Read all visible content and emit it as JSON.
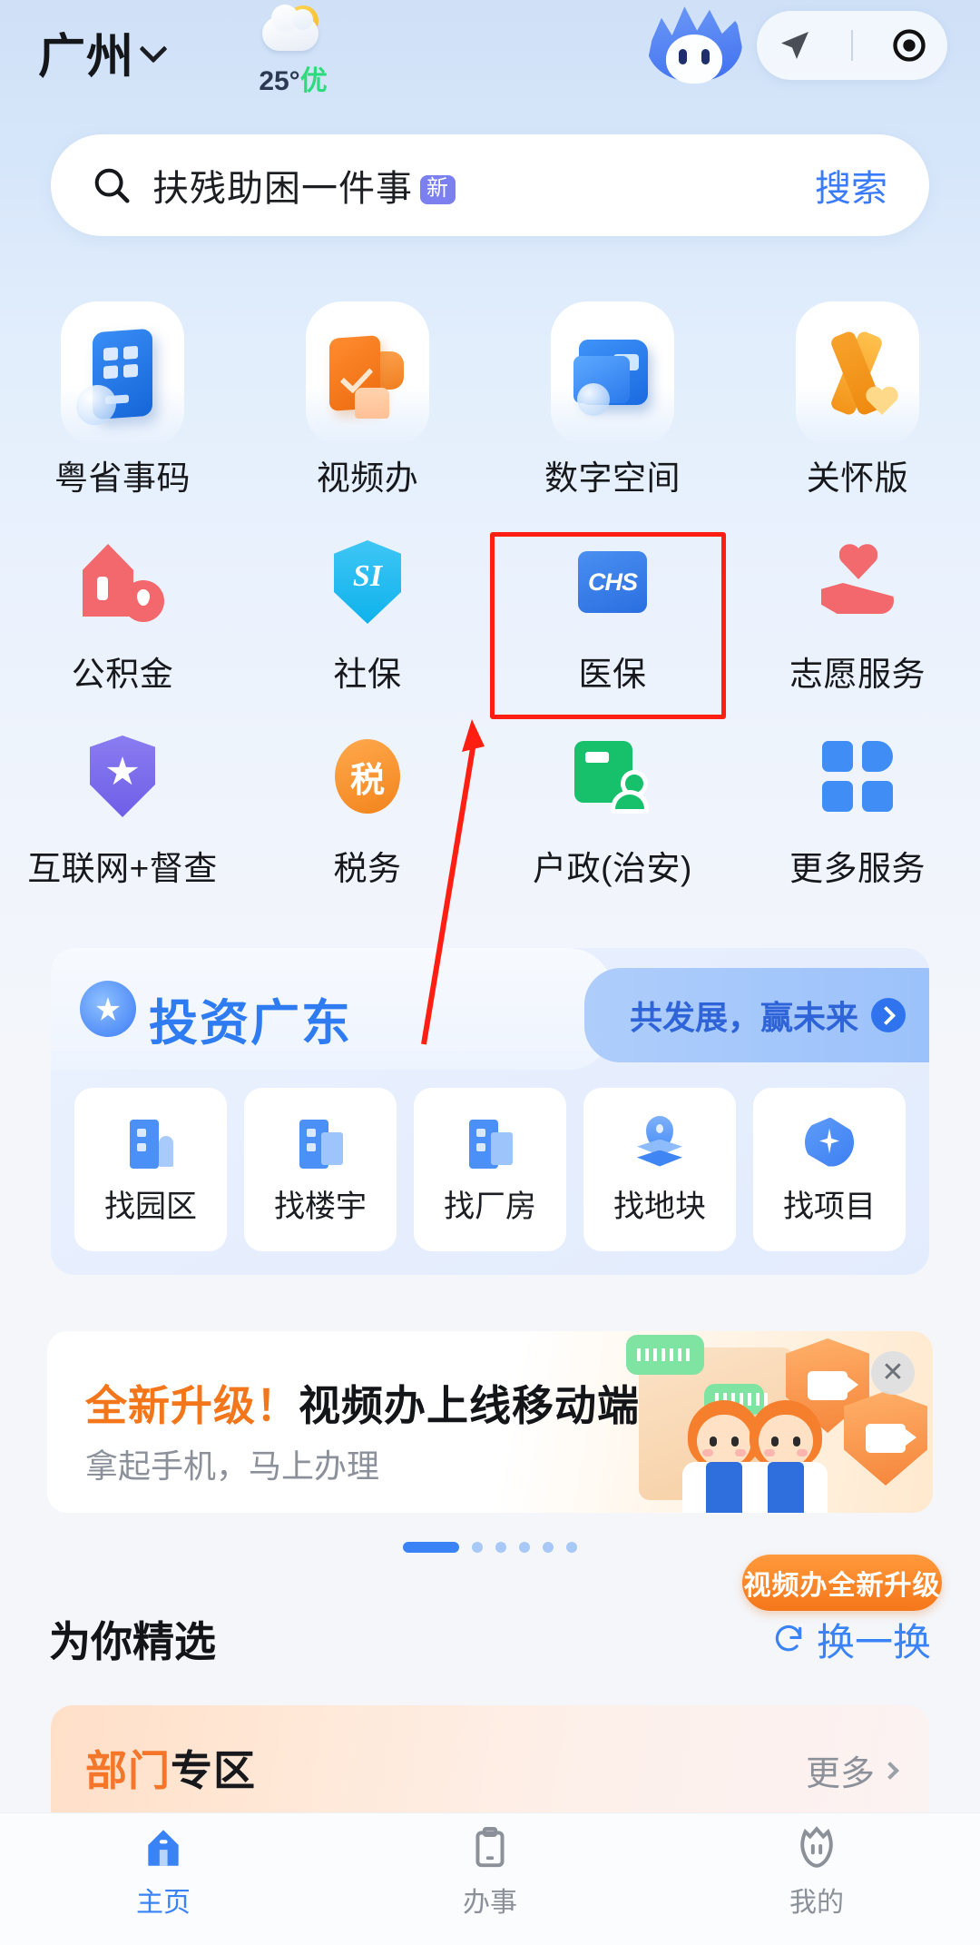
{
  "header": {
    "city": "广州",
    "chevron_icon": "chevron-down-icon",
    "weather": {
      "temperature": "25°",
      "aqi": "优",
      "icon": "partly-cloudy-icon"
    },
    "mascot_icon": "mascot-avatar",
    "actions": [
      {
        "name": "navigation-arrow-icon",
        "label": ""
      },
      {
        "name": "record-target-icon",
        "label": ""
      }
    ]
  },
  "search": {
    "icon": "search-icon",
    "query": "扶残助困一件事",
    "badge": "新",
    "button_label": "搜索"
  },
  "grid": {
    "rows": [
      [
        {
          "label": "粤省事码",
          "icon": "qr-card-icon"
        },
        {
          "label": "视频办",
          "icon": "video-service-icon"
        },
        {
          "label": "数字空间",
          "icon": "digital-space-folder-icon"
        },
        {
          "label": "关怀版",
          "icon": "care-ribbon-icon"
        }
      ],
      [
        {
          "label": "公积金",
          "icon": "house-fund-icon"
        },
        {
          "label": "社保",
          "icon": "social-insurance-shield-icon"
        },
        {
          "label": "医保",
          "icon": "chs-medical-insurance-icon"
        },
        {
          "label": "志愿服务",
          "icon": "volunteer-heart-hand-icon"
        }
      ],
      [
        {
          "label": "互联网+督查",
          "icon": "supervision-shield-star-icon"
        },
        {
          "label": "税务",
          "icon": "tax-icon"
        },
        {
          "label": "户政(治安)",
          "icon": "household-police-card-icon"
        },
        {
          "label": "更多服务",
          "icon": "more-grid-icon"
        }
      ]
    ]
  },
  "invest": {
    "logo_icon": "invest-guangdong-logo",
    "title": "投资广东",
    "tagline": "共发展，赢未来",
    "tagline_arrow_icon": "chevron-right-circle-icon",
    "items": [
      {
        "label": "找园区",
        "icon": "park-building-icon"
      },
      {
        "label": "找楼宇",
        "icon": "office-tower-icon"
      },
      {
        "label": "找厂房",
        "icon": "factory-icon"
      },
      {
        "label": "找地块",
        "icon": "land-plot-pin-icon"
      },
      {
        "label": "找项目",
        "icon": "project-star-icon"
      }
    ]
  },
  "promo": {
    "title_highlight": "全新升级！",
    "title_rest": "视频办上线移动端",
    "subtitle": "拿起手机，马上办理",
    "close_icon": "close-icon",
    "badge": "视频办全新升级",
    "carousel": {
      "total_dots": 6,
      "active_index": 0
    }
  },
  "featured": {
    "title": "为你精选",
    "refresh_icon": "refresh-icon",
    "refresh_label": "换一换"
  },
  "dept_card": {
    "title_orange": "部门",
    "title_black": "专区",
    "more_label": "更多",
    "more_icon": "chevron-right-icon"
  },
  "tabbar": {
    "tabs": [
      {
        "label": "主页",
        "icon": "home-icon",
        "active": true
      },
      {
        "label": "办事",
        "icon": "clipboard-icon",
        "active": false
      },
      {
        "label": "我的",
        "icon": "profile-mascot-icon",
        "active": false
      }
    ]
  },
  "annotation": {
    "highlight_target": "医保",
    "box_color": "#ff1f12",
    "arrow_color": "#ff1f12"
  },
  "colors": {
    "accent_blue": "#3a83f6",
    "orange": "#f4762a",
    "green": "#2ddb7c",
    "bg_top": "#cfe0f7",
    "bg_bottom": "#f5f6fa"
  }
}
